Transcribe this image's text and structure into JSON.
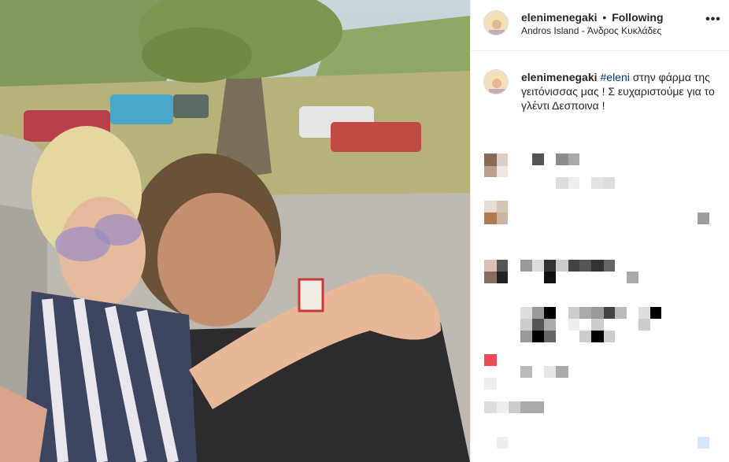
{
  "post": {
    "username": "elenimenegaki",
    "separator": "•",
    "follow_state": "Following",
    "location": "Andros Island - Άνδρος Κυκλάδες",
    "more_label": "•••"
  },
  "caption": {
    "username": "elenimenegaki",
    "hashtag": "#eleni",
    "text": " στην φάρμα της γειτόνισσας μας ! Σ ευχαριστούμε για το γλέντι Δεσποινα !"
  },
  "icons": {
    "more": "more-options-icon",
    "avatar": "profile-avatar"
  },
  "colors": {
    "username": "#262626",
    "hashtag": "#00376b",
    "divider": "#efefef"
  }
}
